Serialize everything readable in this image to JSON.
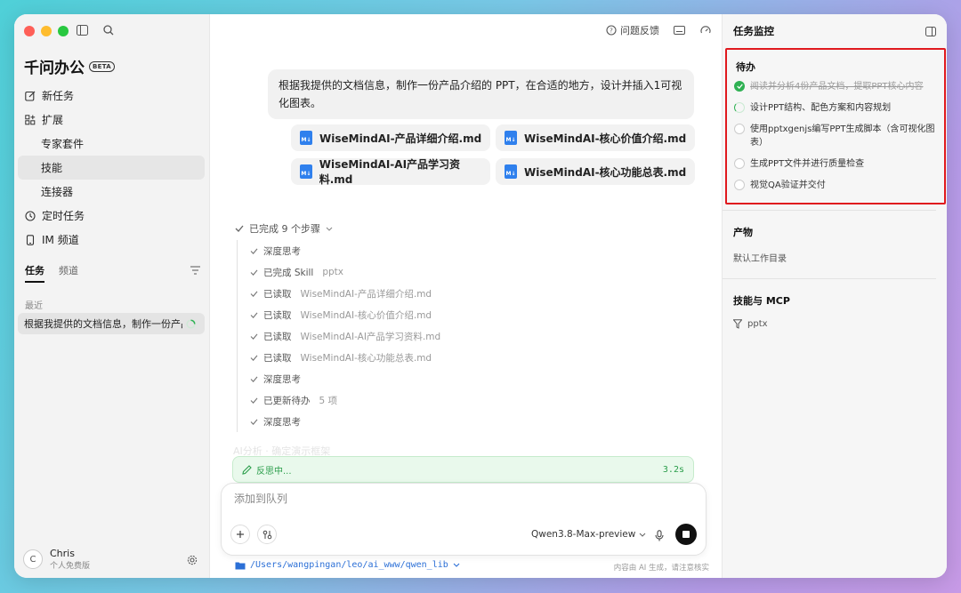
{
  "sidebar": {
    "brand": "千问办公",
    "beta": "BETA",
    "nav": {
      "new_task": "新任务",
      "extend": "扩展",
      "expert_kits": "专家套件",
      "skills": "技能",
      "connectors": "连接器",
      "scheduled": "定时任务",
      "im_channel": "IM 频道"
    },
    "tabs": [
      "任务",
      "频道"
    ],
    "recent_label": "最近",
    "recent_item": "根据我提供的文档信息，制作一份产品介绍的PPT",
    "user": {
      "initial": "C",
      "name": "Chris",
      "plan": "个人免费版"
    }
  },
  "topbar": {
    "feedback": "问题反馈"
  },
  "chat": {
    "message": "根据我提供的文档信息，制作一份产品介绍的 PPT，在合适的地方，设计并插入1可视化图表。",
    "files": [
      "WiseMindAI-产品详细介绍.md",
      "WiseMindAI-核心价值介绍.md",
      "WiseMindAI-AI产品学习资料.md",
      "WiseMindAI-核心功能总表.md"
    ],
    "file_icon_label": "M↓",
    "steps_header": "已完成 9 个步骤",
    "steps": [
      {
        "label": "深度思考",
        "detail": ""
      },
      {
        "label": "已完成  Skill",
        "detail": "pptx"
      },
      {
        "label": "已读取",
        "detail": "WiseMindAI-产品详细介绍.md"
      },
      {
        "label": "已读取",
        "detail": "WiseMindAI-核心价值介绍.md"
      },
      {
        "label": "已读取",
        "detail": "WiseMindAI-AI产品学习资料.md"
      },
      {
        "label": "已读取",
        "detail": "WiseMindAI-核心功能总表.md"
      },
      {
        "label": "深度思考",
        "detail": ""
      },
      {
        "label": "已更新待办",
        "detail": "5 项"
      },
      {
        "label": "深度思考",
        "detail": ""
      }
    ],
    "faded_text": "AI分析 · 确定演示框架",
    "reflect_label": "反思中...",
    "reflect_time": "3.2s"
  },
  "composer": {
    "placeholder": "添加到队列",
    "model": "Qwen3.8-Max-preview"
  },
  "footer": {
    "path": "/Users/wangpingan/leo/ai_www/qwen_lib",
    "disclaimer": "内容由 AI 生成，请注意核实"
  },
  "panel": {
    "title": "任务监控",
    "todo_title": "待办",
    "todos": [
      {
        "text": "阅读并分析4份产品文档，提取PPT核心内容",
        "status": "done"
      },
      {
        "text": "设计PPT结构、配色方案和内容规划",
        "status": "in-progress"
      },
      {
        "text": "使用pptxgenjs编写PPT生成脚本（含可视化图表）",
        "status": "todo"
      },
      {
        "text": "生成PPT文件并进行质量检查",
        "status": "todo"
      },
      {
        "text": "视觉QA验证并交付",
        "status": "todo"
      }
    ],
    "artifacts_title": "产物",
    "artifacts_text": "默认工作目录",
    "skills_title": "技能与 MCP",
    "skill_item": "pptx"
  },
  "colors": {
    "accent_green": "#2fb153",
    "highlight_red": "#e0191e",
    "link_blue": "#2b6fd6"
  }
}
